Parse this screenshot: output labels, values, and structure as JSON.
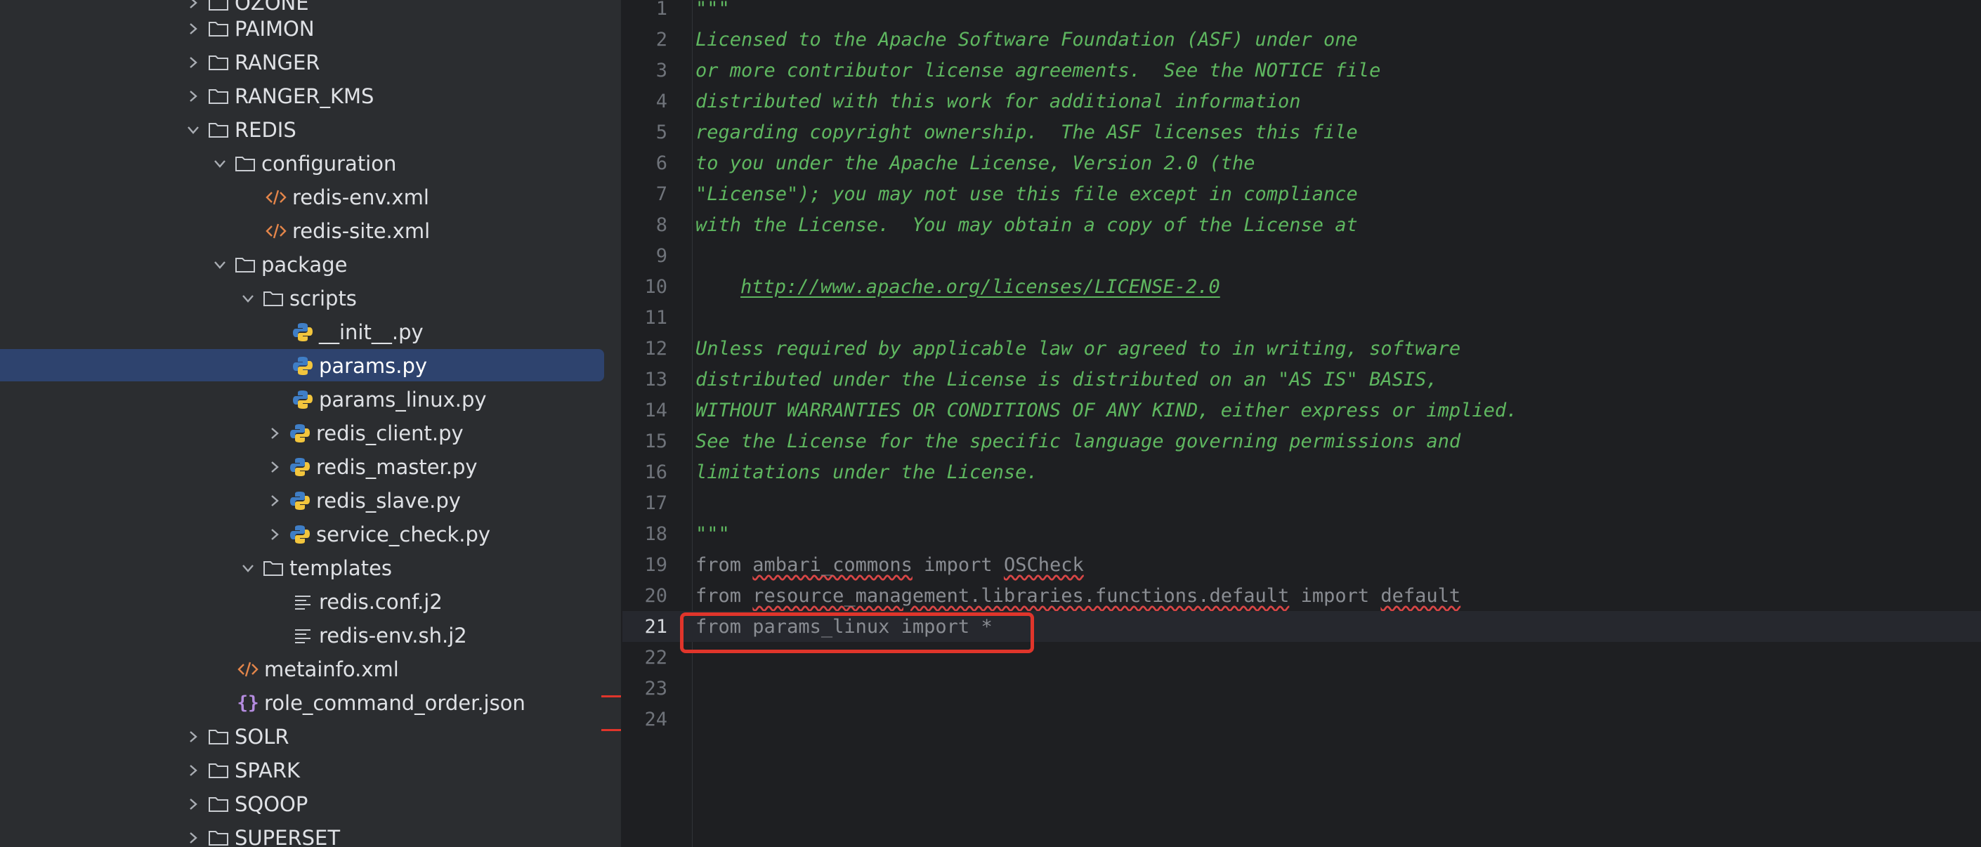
{
  "project_tree": {
    "items": [
      {
        "label": "OZONE",
        "icon": "folder-icon",
        "expanded": false
      },
      {
        "label": "PAIMON",
        "icon": "folder-icon",
        "expanded": false
      },
      {
        "label": "RANGER",
        "icon": "folder-icon",
        "expanded": false
      },
      {
        "label": "RANGER_KMS",
        "icon": "folder-icon",
        "expanded": false
      },
      {
        "label": "REDIS",
        "icon": "folder-icon",
        "expanded": true
      },
      {
        "label": "configuration",
        "icon": "folder-icon",
        "expanded": true
      },
      {
        "label": "redis-env.xml",
        "icon": "xml-file-icon"
      },
      {
        "label": "redis-site.xml",
        "icon": "xml-file-icon"
      },
      {
        "label": "package",
        "icon": "folder-icon",
        "expanded": true
      },
      {
        "label": "scripts",
        "icon": "folder-icon",
        "expanded": true
      },
      {
        "label": "__init__.py",
        "icon": "python-file-icon"
      },
      {
        "label": "params.py",
        "icon": "python-file-icon",
        "selected": true
      },
      {
        "label": "params_linux.py",
        "icon": "python-file-icon"
      },
      {
        "label": "redis_client.py",
        "icon": "python-file-icon",
        "expanded": false
      },
      {
        "label": "redis_master.py",
        "icon": "python-file-icon",
        "expanded": false
      },
      {
        "label": "redis_slave.py",
        "icon": "python-file-icon",
        "expanded": false
      },
      {
        "label": "service_check.py",
        "icon": "python-file-icon",
        "expanded": false
      },
      {
        "label": "templates",
        "icon": "folder-icon",
        "expanded": true
      },
      {
        "label": "redis.conf.j2",
        "icon": "text-file-icon"
      },
      {
        "label": "redis-env.sh.j2",
        "icon": "text-file-icon"
      },
      {
        "label": "metainfo.xml",
        "icon": "xml-file-icon"
      },
      {
        "label": "role_command_order.json",
        "icon": "json-file-icon"
      },
      {
        "label": "SOLR",
        "icon": "folder-icon",
        "expanded": false
      },
      {
        "label": "SPARK",
        "icon": "folder-icon",
        "expanded": false
      },
      {
        "label": "SQOOP",
        "icon": "folder-icon",
        "expanded": false
      },
      {
        "label": "SUPERSET",
        "icon": "folder-icon",
        "expanded": false
      }
    ]
  },
  "editor": {
    "current_line": "21",
    "lines": [
      {
        "n": "1",
        "text": "\"\"\""
      },
      {
        "n": "2",
        "text": "Licensed to the Apache Software Foundation (ASF) under one"
      },
      {
        "n": "3",
        "text": "or more contributor license agreements.  See the NOTICE file"
      },
      {
        "n": "4",
        "text": "distributed with this work for additional information"
      },
      {
        "n": "5",
        "text": "regarding copyright ownership.  The ASF licenses this file"
      },
      {
        "n": "6",
        "text": "to you under the Apache License, Version 2.0 (the"
      },
      {
        "n": "7",
        "text": "\"License\"); you may not use this file except in compliance"
      },
      {
        "n": "8",
        "text": "with the License.  You may obtain a copy of the License at"
      },
      {
        "n": "9",
        "text": ""
      },
      {
        "n": "10",
        "text": "http://www.apache.org/licenses/LICENSE-2.0"
      },
      {
        "n": "11",
        "text": ""
      },
      {
        "n": "12",
        "text": "Unless required by applicable law or agreed to in writing, software"
      },
      {
        "n": "13",
        "text": "distributed under the License is distributed on an \"AS IS\" BASIS,"
      },
      {
        "n": "14",
        "text": "WITHOUT WARRANTIES OR CONDITIONS OF ANY KIND, either express or implied."
      },
      {
        "n": "15",
        "text": "See the License for the specific language governing permissions and"
      },
      {
        "n": "16",
        "text": "limitations under the License."
      },
      {
        "n": "17",
        "text": ""
      },
      {
        "n": "18",
        "text": "\"\"\""
      },
      {
        "n": "19",
        "parts": [
          "from",
          "ambari_commons",
          "import",
          "OSCheck"
        ]
      },
      {
        "n": "20",
        "parts": [
          "from",
          "resource_management.libraries.functions.default",
          "import",
          "default"
        ]
      },
      {
        "n": "21",
        "parts": [
          "from",
          "params_linux",
          "import",
          "*"
        ]
      },
      {
        "n": "22",
        "text": ""
      },
      {
        "n": "23",
        "text": ""
      },
      {
        "n": "24",
        "text": ""
      }
    ]
  },
  "colors": {
    "doc_comment": "#5fb760",
    "highlight_box": "#e0352b",
    "selection": "#2e436e"
  }
}
